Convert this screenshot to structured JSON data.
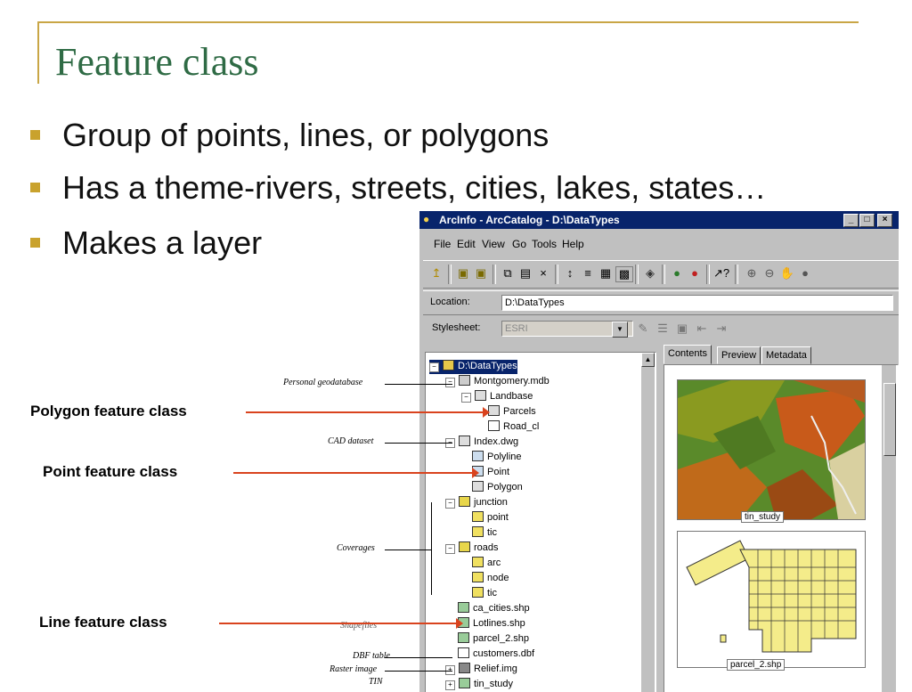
{
  "slide": {
    "title": "Feature class",
    "bullets": [
      "Group of points, lines, or polygons",
      "Has a theme-rivers, streets, cities, lakes, states…",
      "Makes a layer"
    ]
  },
  "window": {
    "title": "ArcInfo - ArcCatalog - D:\\DataTypes",
    "menus": [
      "File",
      "Edit",
      "View",
      "Go",
      "Tools",
      "Help"
    ],
    "location_label": "Location:",
    "location_value": "D:\\DataTypes",
    "stylesheet_label": "Stylesheet:",
    "stylesheet_value": "ESRI",
    "tabs": [
      "Contents",
      "Preview",
      "Metadata"
    ],
    "tree": [
      {
        "label": "D:\\DataTypes",
        "icon": "folder-icon"
      },
      {
        "label": "Montgomery.mdb",
        "icon": "geodatabase-icon"
      },
      {
        "label": "Landbase",
        "icon": "dataset-icon"
      },
      {
        "label": "Parcels",
        "icon": "polygon-layer-icon"
      },
      {
        "label": "Road_cl",
        "icon": "line-layer-icon"
      },
      {
        "label": "Index.dwg",
        "icon": "cad-icon"
      },
      {
        "label": "Polyline",
        "icon": "line-layer-icon"
      },
      {
        "label": "Point",
        "icon": "point-layer-icon"
      },
      {
        "label": "Polygon",
        "icon": "polygon-layer-icon"
      },
      {
        "label": "junction",
        "icon": "coverage-icon"
      },
      {
        "label": "point",
        "icon": "point-layer-icon"
      },
      {
        "label": "tic",
        "icon": "tic-layer-icon"
      },
      {
        "label": "roads",
        "icon": "coverage-icon"
      },
      {
        "label": "arc",
        "icon": "line-layer-icon"
      },
      {
        "label": "node",
        "icon": "point-layer-icon"
      },
      {
        "label": "tic",
        "icon": "tic-layer-icon"
      },
      {
        "label": "ca_cities.shp",
        "icon": "shapefile-icon"
      },
      {
        "label": "Lotlines.shp",
        "icon": "shapefile-icon"
      },
      {
        "label": "parcel_2.shp",
        "icon": "shapefile-icon"
      },
      {
        "label": "customers.dbf",
        "icon": "table-icon"
      },
      {
        "label": "Relief.img",
        "icon": "raster-icon"
      },
      {
        "label": "tin_study",
        "icon": "tin-icon"
      }
    ],
    "thumbnails": [
      {
        "caption": "tin_study"
      },
      {
        "caption": "parcel_2.shp"
      }
    ]
  },
  "annotations": {
    "polygon": "Polygon feature class",
    "point": "Point feature class",
    "line": "Line feature class"
  },
  "side_labels": {
    "personal_gdb": "Personal geodatabase",
    "cad": "CAD dataset",
    "coverages": "Coverages",
    "shapefiles": "Shapefiles",
    "dbf": "DBF table",
    "raster": "Raster image",
    "tin": "TIN"
  },
  "colors": {
    "title": "#2f6b45",
    "bullet": "#c9a22d",
    "frame": "#c9a646",
    "arrow": "#d9431e",
    "titlebar": "#08246b"
  }
}
